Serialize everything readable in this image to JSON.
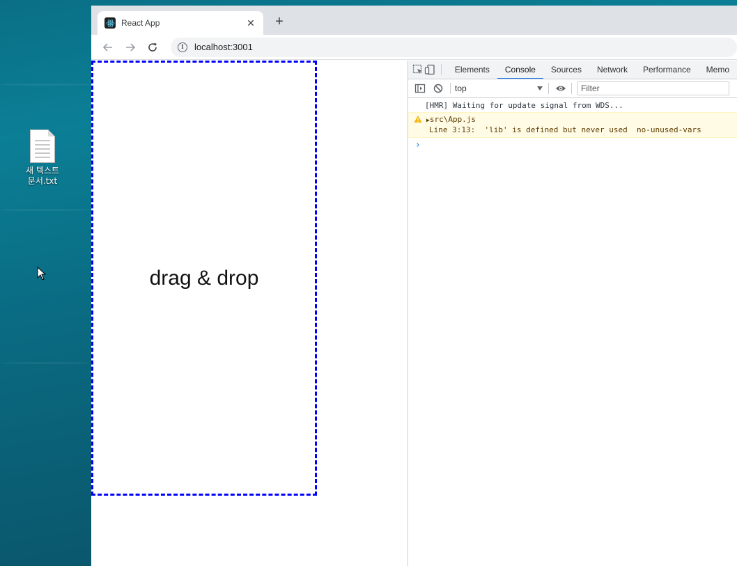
{
  "desktop": {
    "file_label_line1": "새 텍스트",
    "file_label_line2": "문서.txt"
  },
  "browser": {
    "tab_title": "React App",
    "tab_close": "✕",
    "new_tab": "+",
    "url": "localhost:3001"
  },
  "page": {
    "dropzone_text": "drag & drop",
    "dropzone_border_color": "#0000ff"
  },
  "devtools": {
    "tabs": [
      "Elements",
      "Console",
      "Sources",
      "Network",
      "Performance",
      "Memo"
    ],
    "active_tab": "Console",
    "context": "top",
    "filter_placeholder": "Filter",
    "logs": {
      "hmr": "[HMR] Waiting for update signal from WDS...",
      "warn_file": "src\\App.js",
      "warn_detail": "Line 3:13:  'lib' is defined but never used  no-unused-vars"
    },
    "prompt": "›"
  },
  "colors": {
    "accent": "#1a73e8",
    "warning_bg": "#fffbe5",
    "warning_icon": "#f4b400"
  }
}
